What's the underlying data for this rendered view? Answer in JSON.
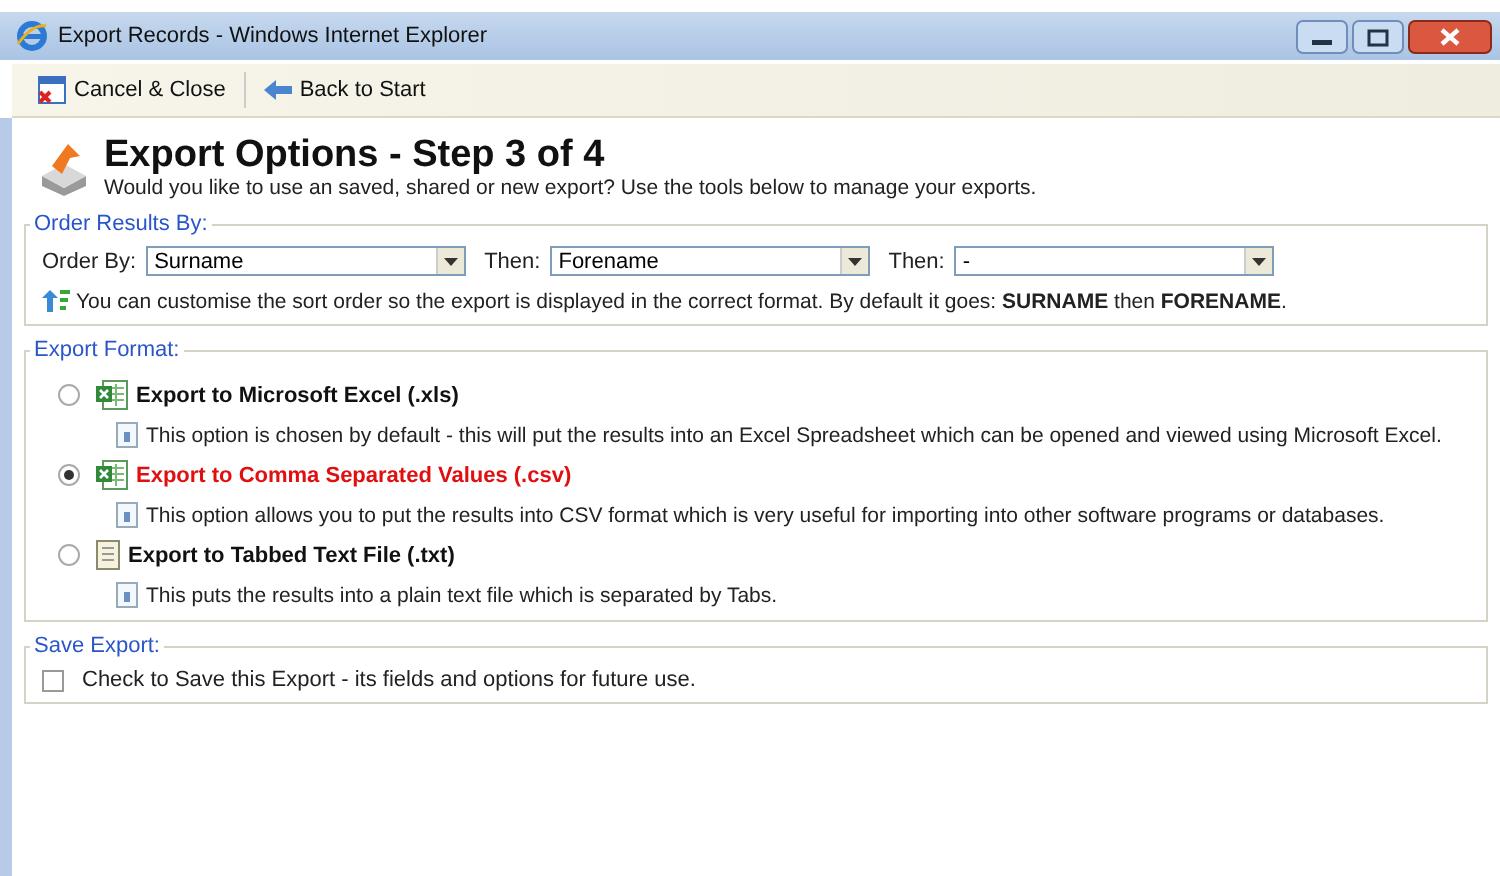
{
  "window": {
    "title": "Export Records - Windows Internet Explorer"
  },
  "toolbar": [
    {
      "kind": "close",
      "label": "Cancel & Close"
    },
    {
      "kind": "back",
      "label": "Back to Start"
    }
  ],
  "header": {
    "title": "Export Options - Step 3 of 4",
    "subtitle": "Would you like to use an saved, shared or new export? Use the tools below to manage your exports."
  },
  "order": {
    "legend": "Order Results By:",
    "fields": [
      {
        "label": "Order By:",
        "value": "Surname"
      },
      {
        "label": "Then:",
        "value": "Forename"
      },
      {
        "label": "Then:",
        "value": "-"
      }
    ],
    "hint": "You can customise the sort order so the export is displayed in the correct format. By default it goes: **SURNAME** then **FORENAME**."
  },
  "format": {
    "legend": "Export Format:",
    "options": [
      {
        "kind": "spreadsheet",
        "label": "Export to Microsoft Excel (.xls)",
        "selected": false,
        "description": "This option is chosen by default - this will put the results into an Excel Spreadsheet which can be opened and viewed using Microsoft Excel."
      },
      {
        "kind": "spreadsheet",
        "label": "Export to Comma Separated Values (.csv)",
        "selected": true,
        "description": "This option allows you to put the results into CSV format which is very useful for importing into other software programs or databases."
      },
      {
        "kind": "text",
        "label": "Export to Tabbed Text File (.txt)",
        "selected": false,
        "description": "This puts the results into a plain text file which is separated by Tabs."
      }
    ]
  },
  "save": {
    "legend": "Save Export:",
    "label": "Check to Save this Export - its fields and options for future use.",
    "checked": false
  }
}
